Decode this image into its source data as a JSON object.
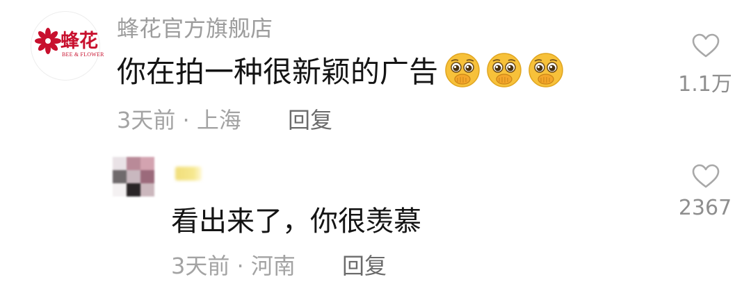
{
  "comments": [
    {
      "avatar": {
        "logo_cn": "蜂花",
        "logo_en": "BEE & FLOWER",
        "icon": "bee-flower-logo"
      },
      "username": "蜂花官方旗舰店",
      "text": "你在拍一种很新颖的广告",
      "emojis": [
        "pleading-face-emoji",
        "pleading-face-emoji",
        "pleading-face-emoji"
      ],
      "time": "3天前",
      "separator": "·",
      "location": "上海",
      "reply_label": "回复",
      "likes": "1.1万",
      "like_icon": "heart-outline-icon"
    },
    {
      "avatar": {
        "icon": "pixelated-avatar"
      },
      "username_hidden": true,
      "text": "看出来了，你很羡慕",
      "time": "3天前",
      "separator": "·",
      "location": "河南",
      "reply_label": "回复",
      "likes": "2367",
      "like_icon": "heart-outline-icon"
    }
  ],
  "colors": {
    "text_primary": "#141414",
    "text_secondary": "#9c9c9c",
    "reply_button": "#6b6b6b",
    "brand_red": "#c8102e",
    "emoji_yellow": "#f7c13a"
  }
}
